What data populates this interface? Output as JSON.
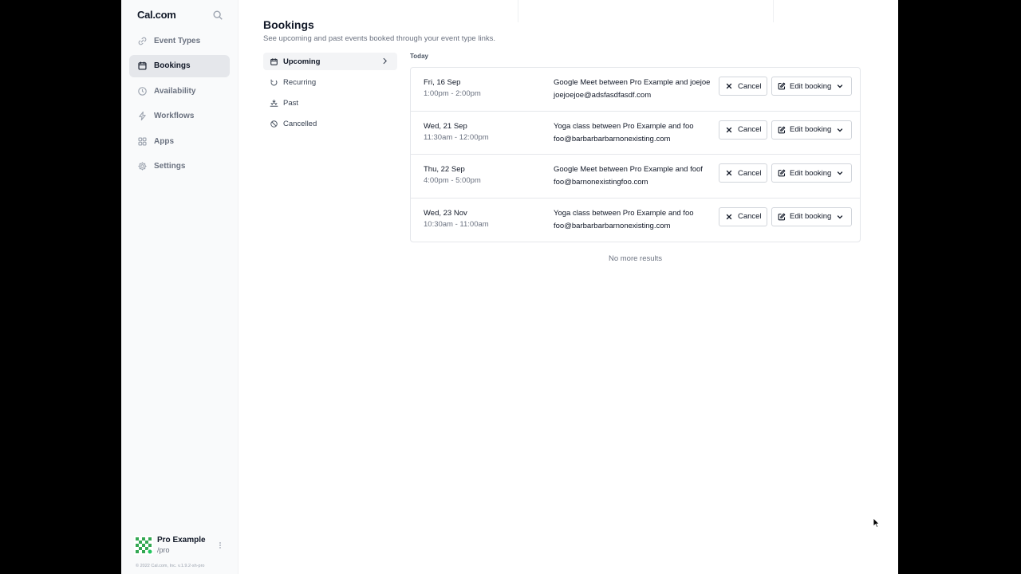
{
  "brand": {
    "name": "Cal.com"
  },
  "sidebar": {
    "items": [
      {
        "label": "Event Types",
        "icon": "link-icon",
        "active": false
      },
      {
        "label": "Bookings",
        "icon": "calendar-icon",
        "active": true
      },
      {
        "label": "Availability",
        "icon": "clock-icon",
        "active": false
      },
      {
        "label": "Workflows",
        "icon": "bolt-icon",
        "active": false
      },
      {
        "label": "Apps",
        "icon": "grid-icon",
        "active": false
      },
      {
        "label": "Settings",
        "icon": "gear-icon",
        "active": false
      }
    ],
    "user": {
      "name": "Pro Example",
      "handle": "/pro"
    },
    "footer": "© 2022 Cal.com, Inc. v.1.9.2-sh-pro"
  },
  "page": {
    "title": "Bookings",
    "subtitle": "See upcoming and past events booked through your event type links."
  },
  "tabs": [
    {
      "label": "Upcoming",
      "icon": "calendar-icon",
      "active": true
    },
    {
      "label": "Recurring",
      "icon": "rotate-icon",
      "active": false
    },
    {
      "label": "Past",
      "icon": "sunset-icon",
      "active": false
    },
    {
      "label": "Cancelled",
      "icon": "ban-icon",
      "active": false
    }
  ],
  "bookings": {
    "section_label": "Today",
    "cancel_label": "Cancel",
    "edit_label": "Edit booking",
    "rows": [
      {
        "date": "Fri, 16 Sep",
        "time": "1:00pm - 2:00pm",
        "title": "Google Meet between Pro Example and joejoe",
        "email": "joejoejoe@adsfasdfasdf.com"
      },
      {
        "date": "Wed, 21 Sep",
        "time": "11:30am - 12:00pm",
        "title": "Yoga class between Pro Example and foo",
        "email": "foo@barbarbarbarnonexisting.com"
      },
      {
        "date": "Thu, 22 Sep",
        "time": "4:00pm - 5:00pm",
        "title": "Google Meet between Pro Example and foof",
        "email": "foo@barnonexistingfoo.com"
      },
      {
        "date": "Wed, 23 Nov",
        "time": "10:30am - 11:00am",
        "title": "Yoga class between Pro Example and foo",
        "email": "foo@barbarbarbarnonexisting.com"
      }
    ],
    "empty_note": "No more results"
  },
  "colors": {
    "sidebar_bg": "#f9fafb",
    "active_bg": "#e5e7eb",
    "text": "#111827",
    "muted": "#6b7280",
    "border": "#e5e7eb",
    "avatar_green": "#34a853"
  }
}
